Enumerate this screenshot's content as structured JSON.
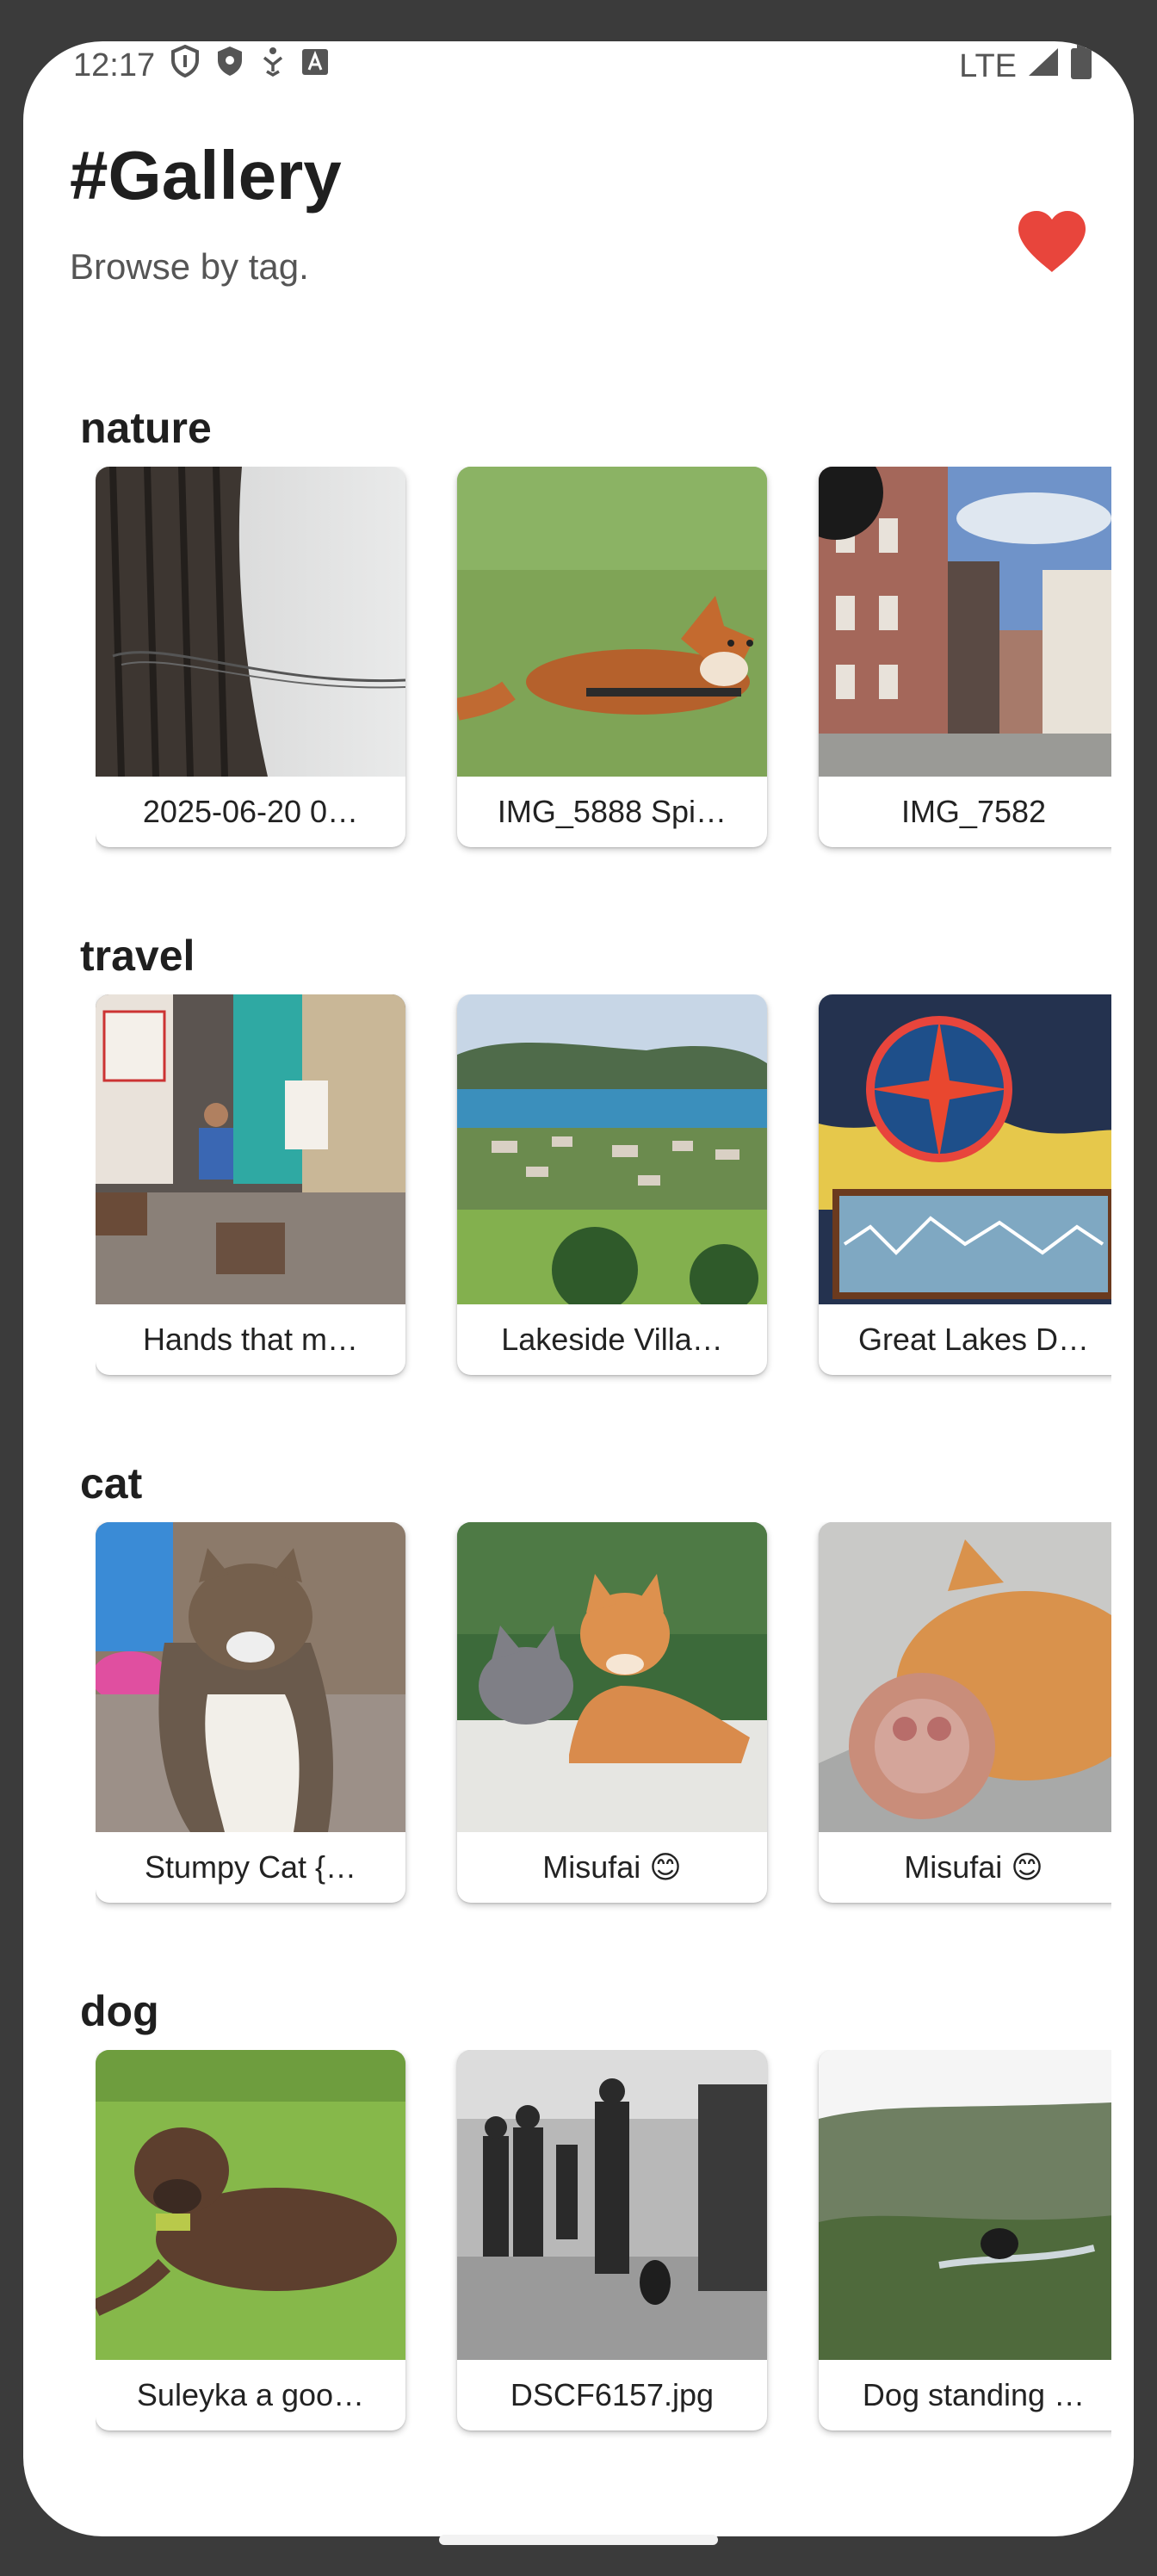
{
  "status_bar": {
    "time": "12:17",
    "network": "LTE",
    "icons": [
      "shield-icon",
      "shield-filled-icon",
      "accessibility-icon",
      "a-icon",
      "signal-icon",
      "battery-icon"
    ]
  },
  "header": {
    "title": "#Gallery",
    "subtitle": "Browse by tag.",
    "favorite_icon": "heart-icon",
    "accent_color": "#e8453c"
  },
  "sections": [
    {
      "tag": "nature",
      "cards": [
        {
          "caption": "2025-06-20 0…",
          "image": "tree trunk with barbed wire"
        },
        {
          "caption": "IMG_5888 Spi…",
          "image": "red fox lying on grass"
        },
        {
          "caption": "IMG_7582",
          "image": "brick building with spiral stairs"
        }
      ]
    },
    {
      "tag": "travel",
      "cards": [
        {
          "caption": "Hands that m…",
          "image": "man sitting in shop doorway"
        },
        {
          "caption": "Lakeside Villa…",
          "image": "lakeside village landscape"
        },
        {
          "caption": "Great Lakes D…",
          "image": "painted compass rose mural"
        }
      ]
    },
    {
      "tag": "cat",
      "cards": [
        {
          "caption": "Stumpy Cat {…",
          "image": "tabby cat sitting on deck"
        },
        {
          "caption": "Misufai 😊",
          "image": "orange cat and grey cat on box"
        },
        {
          "caption": "Misufai 😊",
          "image": "orange cat close-up with paw"
        }
      ]
    },
    {
      "tag": "dog",
      "cards": [
        {
          "caption": "Suleyka a goo…",
          "image": "brown dog lying on grass"
        },
        {
          "caption": "DSCF6157.jpg",
          "image": "black and white street scene with dog"
        },
        {
          "caption": "Dog standing …",
          "image": "dog standing in shrubland"
        }
      ]
    }
  ]
}
